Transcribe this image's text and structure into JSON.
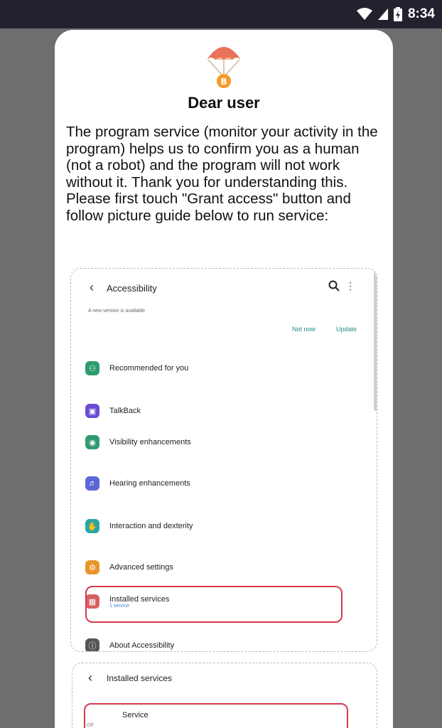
{
  "status_bar": {
    "time": "8:34",
    "icons": [
      "wifi-icon",
      "signal-icon",
      "battery-icon"
    ]
  },
  "dialog": {
    "title": "Dear user",
    "message": "The program service (monitor your activity in the program) helps us to confirm you as a human (not a robot) and the program will not work without it. Thank you for understanding this.\nPlease first touch \"Grant access\" button and follow picture guide below to run service:",
    "logo_icon": "parachute-bitcoin-icon"
  },
  "guide": {
    "screen_title": "Accessibility",
    "notice": "A new version is available",
    "not_now": "Not now",
    "update": "Update",
    "items": [
      {
        "label": "Recommended for you",
        "icon": "accessibility-icon",
        "color": "#2f9b6e"
      },
      {
        "label": "TalkBack",
        "icon": "talkback-icon",
        "color": "#6a4bd1"
      },
      {
        "label": "Visibility enhancements",
        "icon": "visibility-icon",
        "color": "#2f9b6e"
      },
      {
        "label": "Hearing enhancements",
        "icon": "hearing-icon",
        "color": "#5b67d8"
      },
      {
        "label": "Interaction and dexterity",
        "icon": "interaction-icon",
        "color": "#2aa6a6"
      },
      {
        "label": "Advanced settings",
        "icon": "advanced-settings-icon",
        "color": "#e8962a"
      },
      {
        "label": "Installed services",
        "sub": "1 service",
        "icon": "installed-services-icon",
        "color": "#d86060"
      },
      {
        "label": "About Accessibility",
        "icon": "info-icon",
        "color": "#555555"
      }
    ]
  },
  "guide2": {
    "screen_title": "Installed services",
    "service_label": "Service",
    "off_label": "Off"
  },
  "colors": {
    "highlight": "#d83a4c",
    "status_bar": "#22222f",
    "backdrop": "#6e6e6e",
    "link": "#2a8a8a"
  }
}
